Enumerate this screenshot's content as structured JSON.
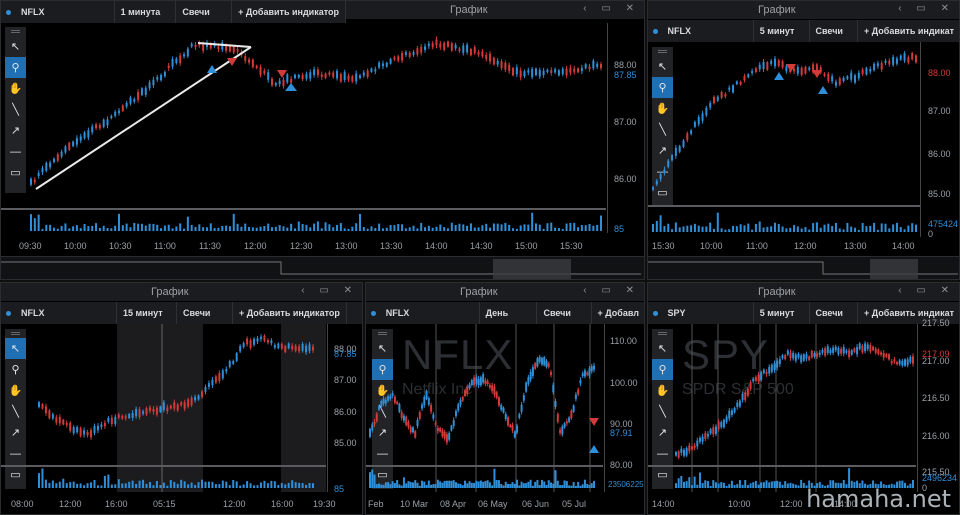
{
  "main": {
    "symbol": "NFLX",
    "interval": "1 минута",
    "chart_type": "Свечи",
    "add_indicator": "+ Добавить индикатор",
    "title": "График",
    "prices": [
      "88.00",
      "87.00",
      "86.00",
      "85"
    ],
    "last_price": "87.85",
    "times": [
      "09:30",
      "10:00",
      "10:30",
      "11:00",
      "11:30",
      "12:00",
      "12:30",
      "13:00",
      "13:30",
      "14:00",
      "14:30",
      "15:00",
      "15:30"
    ]
  },
  "right_top": {
    "title": "График",
    "symbol": "NFLX",
    "interval": "5 минут",
    "chart_type": "Свечи",
    "add_indicator": "+ Добавить индикат",
    "prices": [
      "87.00",
      "86.00",
      "85.00"
    ],
    "last_price": "88.00",
    "volume": "475424",
    "volume_zero": "0",
    "times": [
      "15:30",
      "10:00",
      "11:00",
      "12:00",
      "13:00",
      "14:00"
    ]
  },
  "bottom_left": {
    "title": "График",
    "symbol": "NFLX",
    "interval": "15 минут",
    "chart_type": "Свечи",
    "add_indicator": "+ Добавить индикатор",
    "prices": [
      "87.00",
      "86.00",
      "85.00",
      "85"
    ],
    "last_price": "87.85",
    "last_price_top": "88.00",
    "times": [
      "08:00",
      "12:00",
      "16:00",
      "05:15",
      "12:00",
      "16:00",
      "19:30"
    ]
  },
  "bottom_mid": {
    "title": "График",
    "symbol": "NFLX",
    "interval": "День",
    "chart_type": "Свечи",
    "add_indicator": "+ Добавл",
    "watermark": "NFLX",
    "watermark_sub": "Netflix Inc",
    "prices": [
      "110.00",
      "100.00",
      "90.00",
      "80.00"
    ],
    "last_price": "87.91",
    "volume": "23506225",
    "times": [
      "Feb",
      "10 Mar",
      "08 Apr",
      "06 May",
      "06 Jun",
      "05 Jul"
    ]
  },
  "bottom_right": {
    "title": "График",
    "symbol": "SPY",
    "interval": "5 минут",
    "chart_type": "Свечи",
    "add_indicator": "+ Добавить индикат",
    "watermark": "SPY",
    "watermark_sub": "SPDR S&P 500",
    "prices": [
      "217.50",
      "217.00",
      "216.50",
      "216.00",
      "215.50"
    ],
    "last_price": "217.09",
    "volume": "2496234",
    "volume_zero": "0",
    "times": [
      "14:00",
      "10:00",
      "12:00",
      "14:00"
    ]
  },
  "site": "hamaha.net",
  "colors": {
    "up": "#2f8fd8",
    "down": "#d33a3a",
    "active_tool": "#1f6fb5"
  },
  "tool_icons": [
    "cursor-icon",
    "zoom-icon",
    "hand-icon",
    "line-icon",
    "arrow-icon",
    "hline-icon",
    "rect-icon"
  ]
}
